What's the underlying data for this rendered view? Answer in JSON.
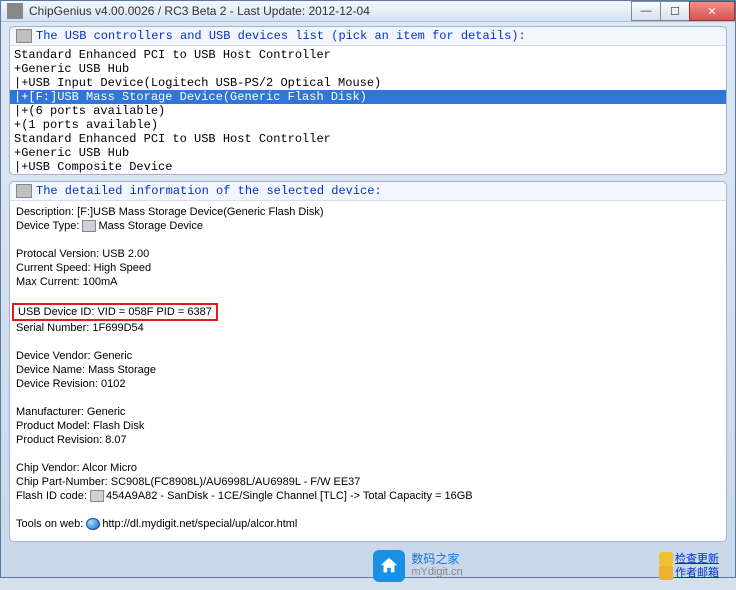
{
  "titlebar": {
    "title": "ChipGenius v4.00.0026 / RC3 Beta 2 - Last Update: 2012-12-04"
  },
  "win_buttons": {
    "min": "—",
    "max": "☐",
    "close": "✕"
  },
  "group1": {
    "header": "The USB controllers and USB devices list (pick an item for details):"
  },
  "devices": [
    "Standard Enhanced PCI to USB Host Controller",
    "+Generic USB Hub",
    "|+USB Input Device(Logitech USB-PS/2 Optical Mouse)",
    "|+[F:]USB Mass Storage Device(Generic Flash Disk)",
    "|+(6 ports available)",
    "+(1 ports available)",
    "Standard Enhanced PCI to USB Host Controller",
    "+Generic USB Hub",
    "|+USB Composite Device"
  ],
  "selected_index": 3,
  "group2": {
    "header": "The detailed information of the selected device:"
  },
  "details": {
    "description_label": "Description: ",
    "description_value": "[F:]USB Mass Storage Device(Generic Flash Disk)",
    "device_type_label": "Device Type: ",
    "device_type_value": "Mass Storage Device",
    "protocol": "Protocal Version: USB 2.00",
    "speed": "Current Speed: High Speed",
    "max_current": "Max Current: 100mA",
    "usb_device_id": "USB Device ID: VID = 058F PID = 6387",
    "serial": "Serial Number: 1F699D54",
    "vendor": "Device Vendor: Generic",
    "name": "Device Name: Mass Storage",
    "revision": "Device Revision: 0102",
    "manufacturer": "Manufacturer: Generic",
    "product_model": "Product Model: Flash Disk",
    "product_revision": "Product Revision: 8.07",
    "chip_vendor": "Chip Vendor: Alcor Micro",
    "chip_part": "Chip Part-Number: SC908L(FC8908L)/AU6998L/AU6989L - F/W EE37",
    "flash_id_label": "Flash ID code: ",
    "flash_id_value": "454A9A82 - SanDisk - 1CE/Single Channel [TLC] -> Total Capacity = 16GB",
    "tools_label": "Tools on web: ",
    "tools_url": "http://dl.mydigit.net/special/up/alcor.html"
  },
  "footer": {
    "brand_cn": "数码之家",
    "brand_en": "mYdigit.cn",
    "link_update": "检查更新",
    "link_mail": "作者邮箱"
  }
}
